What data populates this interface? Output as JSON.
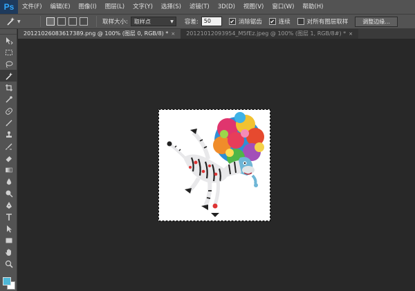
{
  "app": {
    "logo": "Ps"
  },
  "menu": [
    "文件(F)",
    "编辑(E)",
    "图像(I)",
    "图层(L)",
    "文字(Y)",
    "选择(S)",
    "滤镜(T)",
    "3D(D)",
    "视图(V)",
    "窗口(W)",
    "帮助(H)"
  ],
  "options": {
    "sample_size_label": "取样大小:",
    "sample_size_value": "取样点",
    "tolerance_label": "容差:",
    "tolerance_value": "50",
    "anti_alias_label": "消除锯齿",
    "contiguous_label": "连续",
    "sample_all_layers_label": "对所有图层取样",
    "refine_edge_label": "调整边缘..."
  },
  "tabs": [
    {
      "label": "20121026083617389.png @ 100% (图层 0, RGB/8) *",
      "close": "×"
    },
    {
      "label": "20121012093954_M5fEz.jpeg @ 100% (图层 1, RGB/8#) *",
      "close": "×"
    }
  ],
  "toolbar": {
    "tools": [
      "move-icon",
      "marquee-icon",
      "lasso-icon",
      "magic-wand-icon",
      "crop-icon",
      "eyedropper-icon",
      "healing-brush-icon",
      "brush-icon",
      "clone-stamp-icon",
      "history-brush-icon",
      "eraser-icon",
      "gradient-icon",
      "blur-icon",
      "dodge-icon",
      "pen-icon",
      "type-icon",
      "path-selection-icon",
      "rectangle-icon",
      "hand-icon",
      "zoom-icon"
    ],
    "foreground_color": "#4eb8d8",
    "background_color": "#ffffff"
  }
}
